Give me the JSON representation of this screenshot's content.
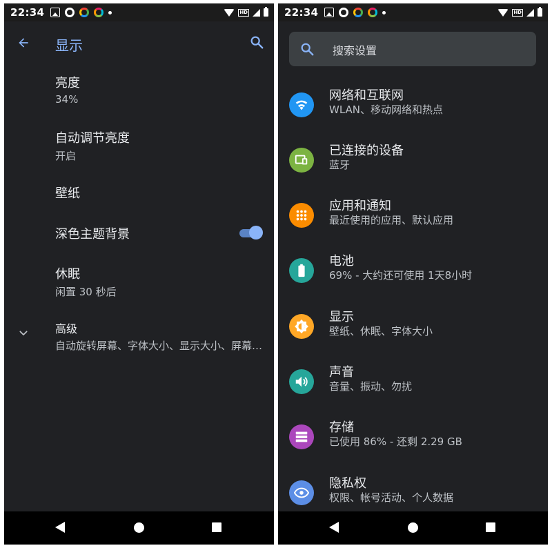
{
  "status_bar": {
    "time": "22:34",
    "hd_label": "HD"
  },
  "display": {
    "title": "显示",
    "items": [
      {
        "title": "亮度",
        "subtitle": "34%"
      },
      {
        "title": "自动调节亮度",
        "subtitle": "开启"
      },
      {
        "title": "壁纸"
      },
      {
        "title": "深色主题背景",
        "toggle_on": true
      },
      {
        "title": "休眠",
        "subtitle": "闲置 30 秒后"
      },
      {
        "title": "高级",
        "subtitle": "自动旋转屏幕、字体大小、显示大小、屏幕保护程序"
      }
    ]
  },
  "settings": {
    "search_placeholder": "搜索设置",
    "categories": [
      {
        "title": "网络和互联网",
        "subtitle": "WLAN、移动网络和热点",
        "icon": "wifi-icon",
        "color": "#2196f3"
      },
      {
        "title": "已连接的设备",
        "subtitle": "蓝牙",
        "icon": "devices-icon",
        "color": "#7cb342"
      },
      {
        "title": "应用和通知",
        "subtitle": "最近使用的应用、默认应用",
        "icon": "apps-icon",
        "color": "#fb8c00"
      },
      {
        "title": "电池",
        "subtitle": "69% - 大约还可使用 1天8小时",
        "icon": "battery-icon",
        "color": "#26a69a"
      },
      {
        "title": "显示",
        "subtitle": "壁纸、休眠、字体大小",
        "icon": "brightness-icon",
        "color": "#ffa726"
      },
      {
        "title": "声音",
        "subtitle": "音量、振动、勿扰",
        "icon": "volume-icon",
        "color": "#26a69a"
      },
      {
        "title": "存储",
        "subtitle": "已使用 86% - 还剩 2.29 GB",
        "icon": "storage-icon",
        "color": "#ab47bc"
      },
      {
        "title": "隐私权",
        "subtitle": "权限、帐号活动、个人数据",
        "icon": "privacy-icon",
        "color": "#5c8ee6"
      }
    ]
  }
}
